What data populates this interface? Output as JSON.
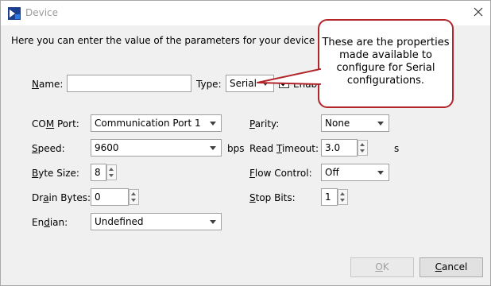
{
  "window": {
    "title": "Device",
    "icon": "app-icon",
    "close_icon": "close-icon"
  },
  "intro": "Here you can enter the value of the parameters for your device co",
  "name": {
    "label": "Name:",
    "access_key": "N",
    "value": ""
  },
  "type": {
    "label": "Type:",
    "value": "Serial"
  },
  "enable": {
    "label": "Enab",
    "checked": true
  },
  "callout": {
    "text": "These are the properties made available to configure for Serial configurations.",
    "border_color": "#b3242b"
  },
  "left_fields": {
    "com_port": {
      "label_pre": "CO",
      "label_ak": "M",
      "label_post": " Port:",
      "value": "Communication Port 1"
    },
    "speed": {
      "label_pre": "",
      "label_ak": "S",
      "label_post": "peed:",
      "value": "9600",
      "unit": "bps"
    },
    "byte_size": {
      "label_pre": "",
      "label_ak": "B",
      "label_post": "yte Size:",
      "value": "8"
    },
    "drain_bytes": {
      "label_pre": "Dr",
      "label_ak": "a",
      "label_post": "in Bytes:",
      "value": "0"
    },
    "endian": {
      "label_pre": "En",
      "label_ak": "d",
      "label_post": "ian:",
      "value": "Undefined"
    }
  },
  "right_fields": {
    "parity": {
      "label_pre": "",
      "label_ak": "P",
      "label_post": "arity:",
      "value": "None"
    },
    "read_timeout": {
      "label_pre": "Read ",
      "label_ak": "T",
      "label_post": "imeout:",
      "value": "3.0",
      "unit": "s"
    },
    "flow_control": {
      "label_pre": "",
      "label_ak": "F",
      "label_post": "low Control:",
      "value": "Off"
    },
    "stop_bits": {
      "label_pre": "",
      "label_ak": "S",
      "label_post": "top Bits:",
      "value": "1"
    }
  },
  "buttons": {
    "ok": {
      "label_ak": "O",
      "label_post": "K",
      "enabled": false
    },
    "cancel": {
      "label_ak": "C",
      "label_post": "ancel",
      "enabled": true
    }
  }
}
